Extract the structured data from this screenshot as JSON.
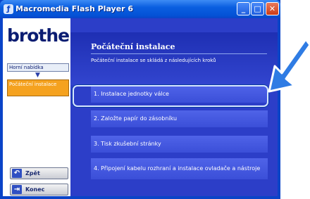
{
  "window": {
    "title": "Macromedia Flash Player 6",
    "app_icon": "flash-icon",
    "controls": {
      "minimize_icon": "minimize-icon",
      "maximize_icon": "maximize-icon",
      "close_icon": "close-icon"
    }
  },
  "sidebar": {
    "logo": "brother",
    "nav_home": "Horní nabídka",
    "nav_arrow": "▼",
    "nav_current": "Počáteční instalace",
    "back_label": "Zpět",
    "back_icon": "back-arrow-icon",
    "exit_label": "Konec",
    "exit_icon": "exit-icon"
  },
  "main": {
    "title": "Počáteční instalace",
    "subtitle": "Počáteční instalace se skládá z následujících kroků",
    "steps": [
      "1. Instalace jednotky válce",
      "2. Založte papír do zásobníku",
      "3. Tisk zkušební stránky",
      "4. Připojení kabelu rozhraní a instalace ovladače a nástroje"
    ]
  },
  "colors": {
    "titlebar": "#0a5ee0",
    "panel": "#2c3ec8",
    "step": "#4f63e8",
    "current_nav": "#f5a21f",
    "pointer_arrow": "#2f7ce4"
  }
}
